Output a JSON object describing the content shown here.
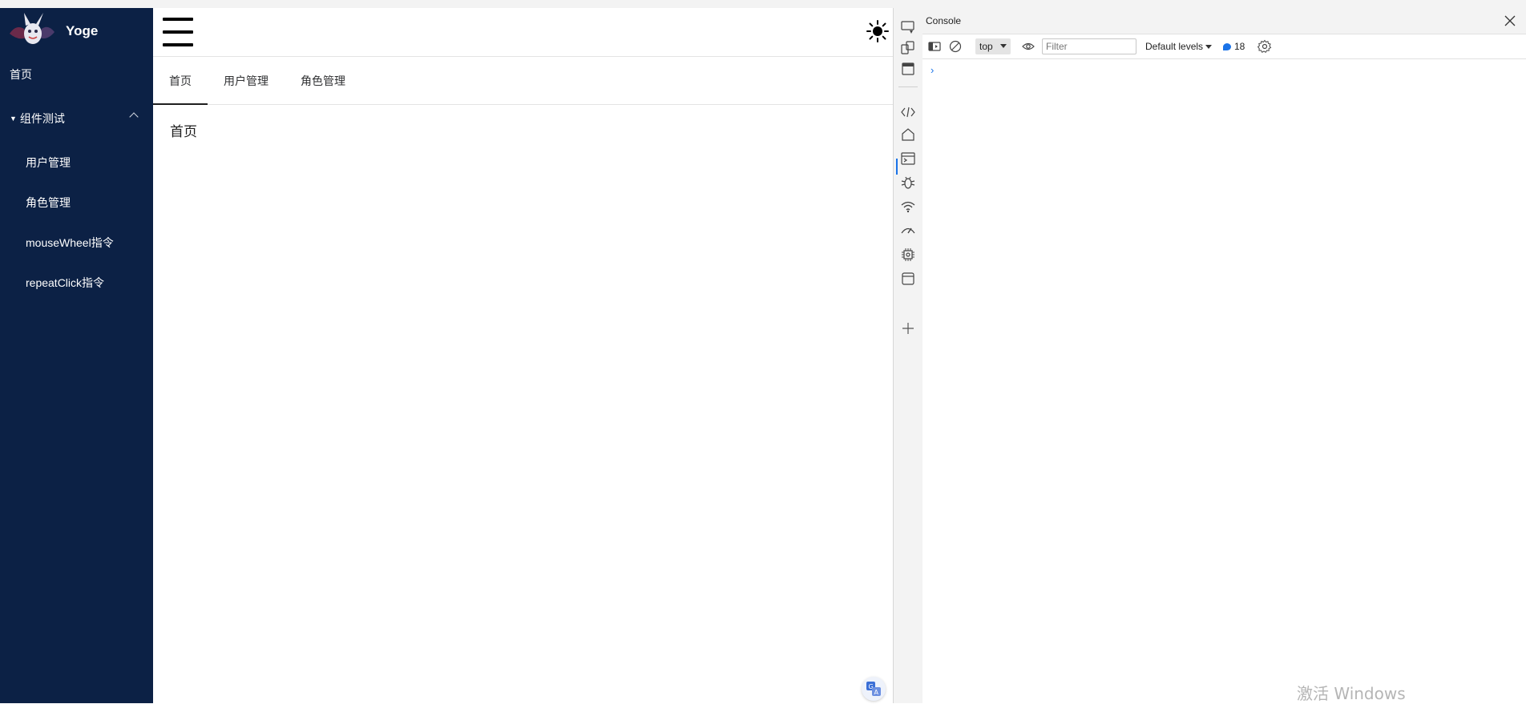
{
  "sidebar": {
    "brand": "Yoge",
    "home": "首页",
    "group": "组件测试",
    "sub_items": [
      "用户管理",
      "角色管理",
      "mouseWheel指令",
      "repeatClick指令"
    ]
  },
  "tabs": [
    "首页",
    "用户管理",
    "角色管理"
  ],
  "content": {
    "title": "首页"
  },
  "devtools": {
    "panel_title": "Console",
    "context": "top",
    "filter_placeholder": "Filter",
    "levels": "Default levels",
    "issues_count": "18",
    "prompt": "›"
  },
  "watermark": "激活 Windows",
  "colors": {
    "sidebar_bg": "#0c2145",
    "accent": "#1a73e8"
  }
}
